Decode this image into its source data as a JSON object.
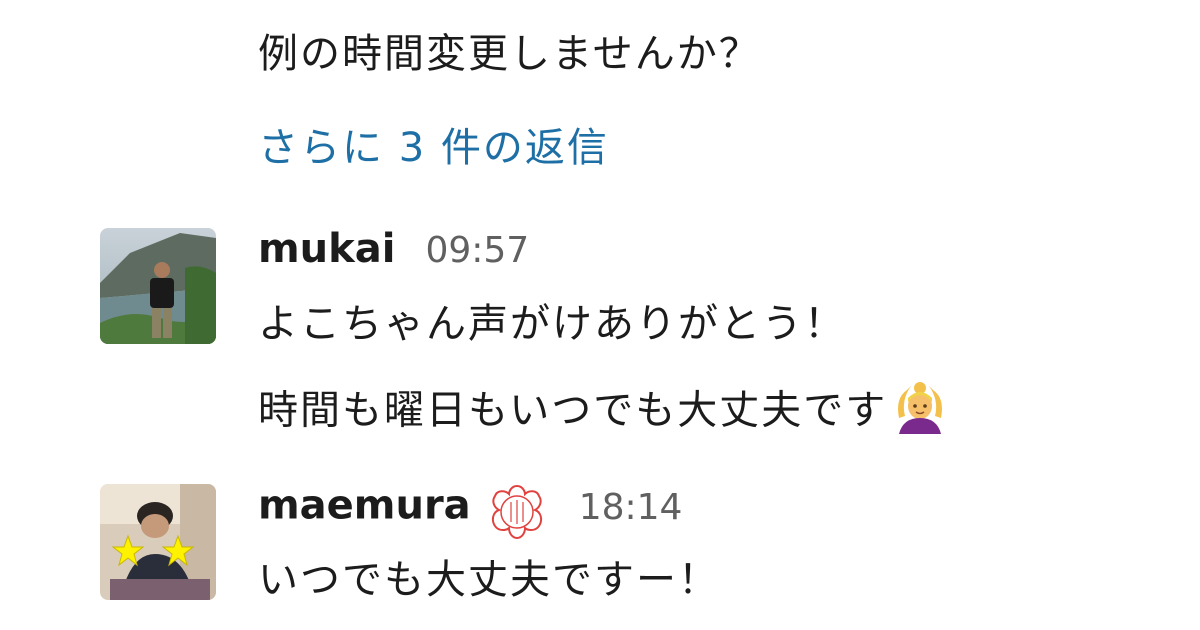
{
  "thread": {
    "prev_message_line": "例の時間変更しませんか？",
    "replies_link": "さらに 3 件の返信"
  },
  "messages": [
    {
      "author": "mukai",
      "time": "09:57",
      "lines": [
        "よこちゃん声がけありがとう！",
        "時間も曜日もいつでも大丈夫です"
      ],
      "emoji": "person-gesturing-ok-emoji"
    },
    {
      "author": "maemura",
      "time": "18:14",
      "lines": [
        "いつでも大丈夫ですー！"
      ],
      "status_icon": "sakura-stamp-icon"
    }
  ],
  "colors": {
    "text": "#1d1c1d",
    "link": "#1d6fa5",
    "timestamp": "#616061",
    "stamp": "#e0433f"
  }
}
